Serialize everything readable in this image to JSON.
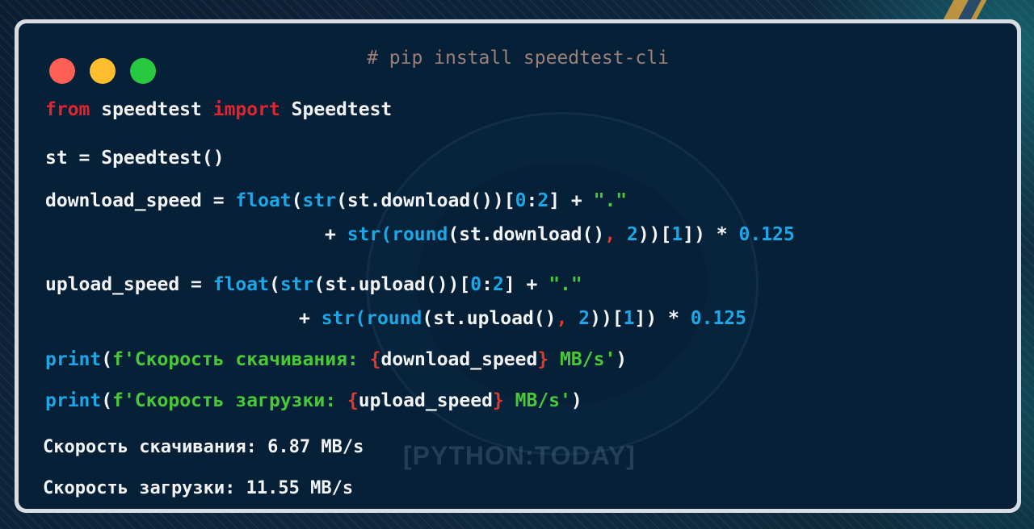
{
  "window": {
    "title_comment": "# pip install speedtest-cli",
    "watermark": "[PYTHON:TODAY]"
  },
  "code": {
    "l1": {
      "a": "from",
      "b": " speedtest ",
      "c": "import",
      "d": " Speedtest"
    },
    "l2": {
      "a": "st = Speedtest()"
    },
    "l3": {
      "a": "download_speed = ",
      "b": "float",
      "c": "(",
      "d": "str",
      "e": "(st.download())[",
      "f": "0",
      "g": ":",
      "h": "2",
      "i": "] + ",
      "j": "\".\""
    },
    "l4": {
      "a": "+ ",
      "b": "str",
      "c": "(",
      "d": "round",
      "e": "(st.download()",
      "f": ",",
      "g": " ",
      "h": "2",
      "i": "))[",
      "j": "1",
      "k": "]) * ",
      "l": "0.125"
    },
    "l5": {
      "a": "upload_speed = ",
      "b": "float",
      "c": "(",
      "d": "str",
      "e": "(st.upload())[",
      "f": "0",
      "g": ":",
      "h": "2",
      "i": "] + ",
      "j": "\".\""
    },
    "l6": {
      "a": "+ ",
      "b": "str",
      "c": "(",
      "d": "round",
      "e": "(st.upload()",
      "f": ",",
      "g": " ",
      "h": "2",
      "i": "))[",
      "j": "1",
      "k": "]) * ",
      "l": "0.125"
    },
    "l7": {
      "a": "print",
      "b": "(",
      "c": "f'Скорость скачивания: ",
      "d": "{",
      "e": "download_speed",
      "f": "}",
      "g": " MB/s'",
      "h": ")"
    },
    "l8": {
      "a": "print",
      "b": "(",
      "c": "f'Скорость загрузки: ",
      "d": "{",
      "e": "upload_speed",
      "f": "}",
      "g": " MB/s'",
      "h": ")"
    }
  },
  "output": {
    "download": "Скорость скачивания: 6.87 MB/s",
    "upload": "Скорость загрузки: 11.55 MB/s"
  },
  "colors": {
    "keyword": "#e0252f",
    "builtin": "#1ea7e6",
    "string": "#49c93a",
    "text": "#f2f4f7",
    "window_bg": "#062038"
  }
}
